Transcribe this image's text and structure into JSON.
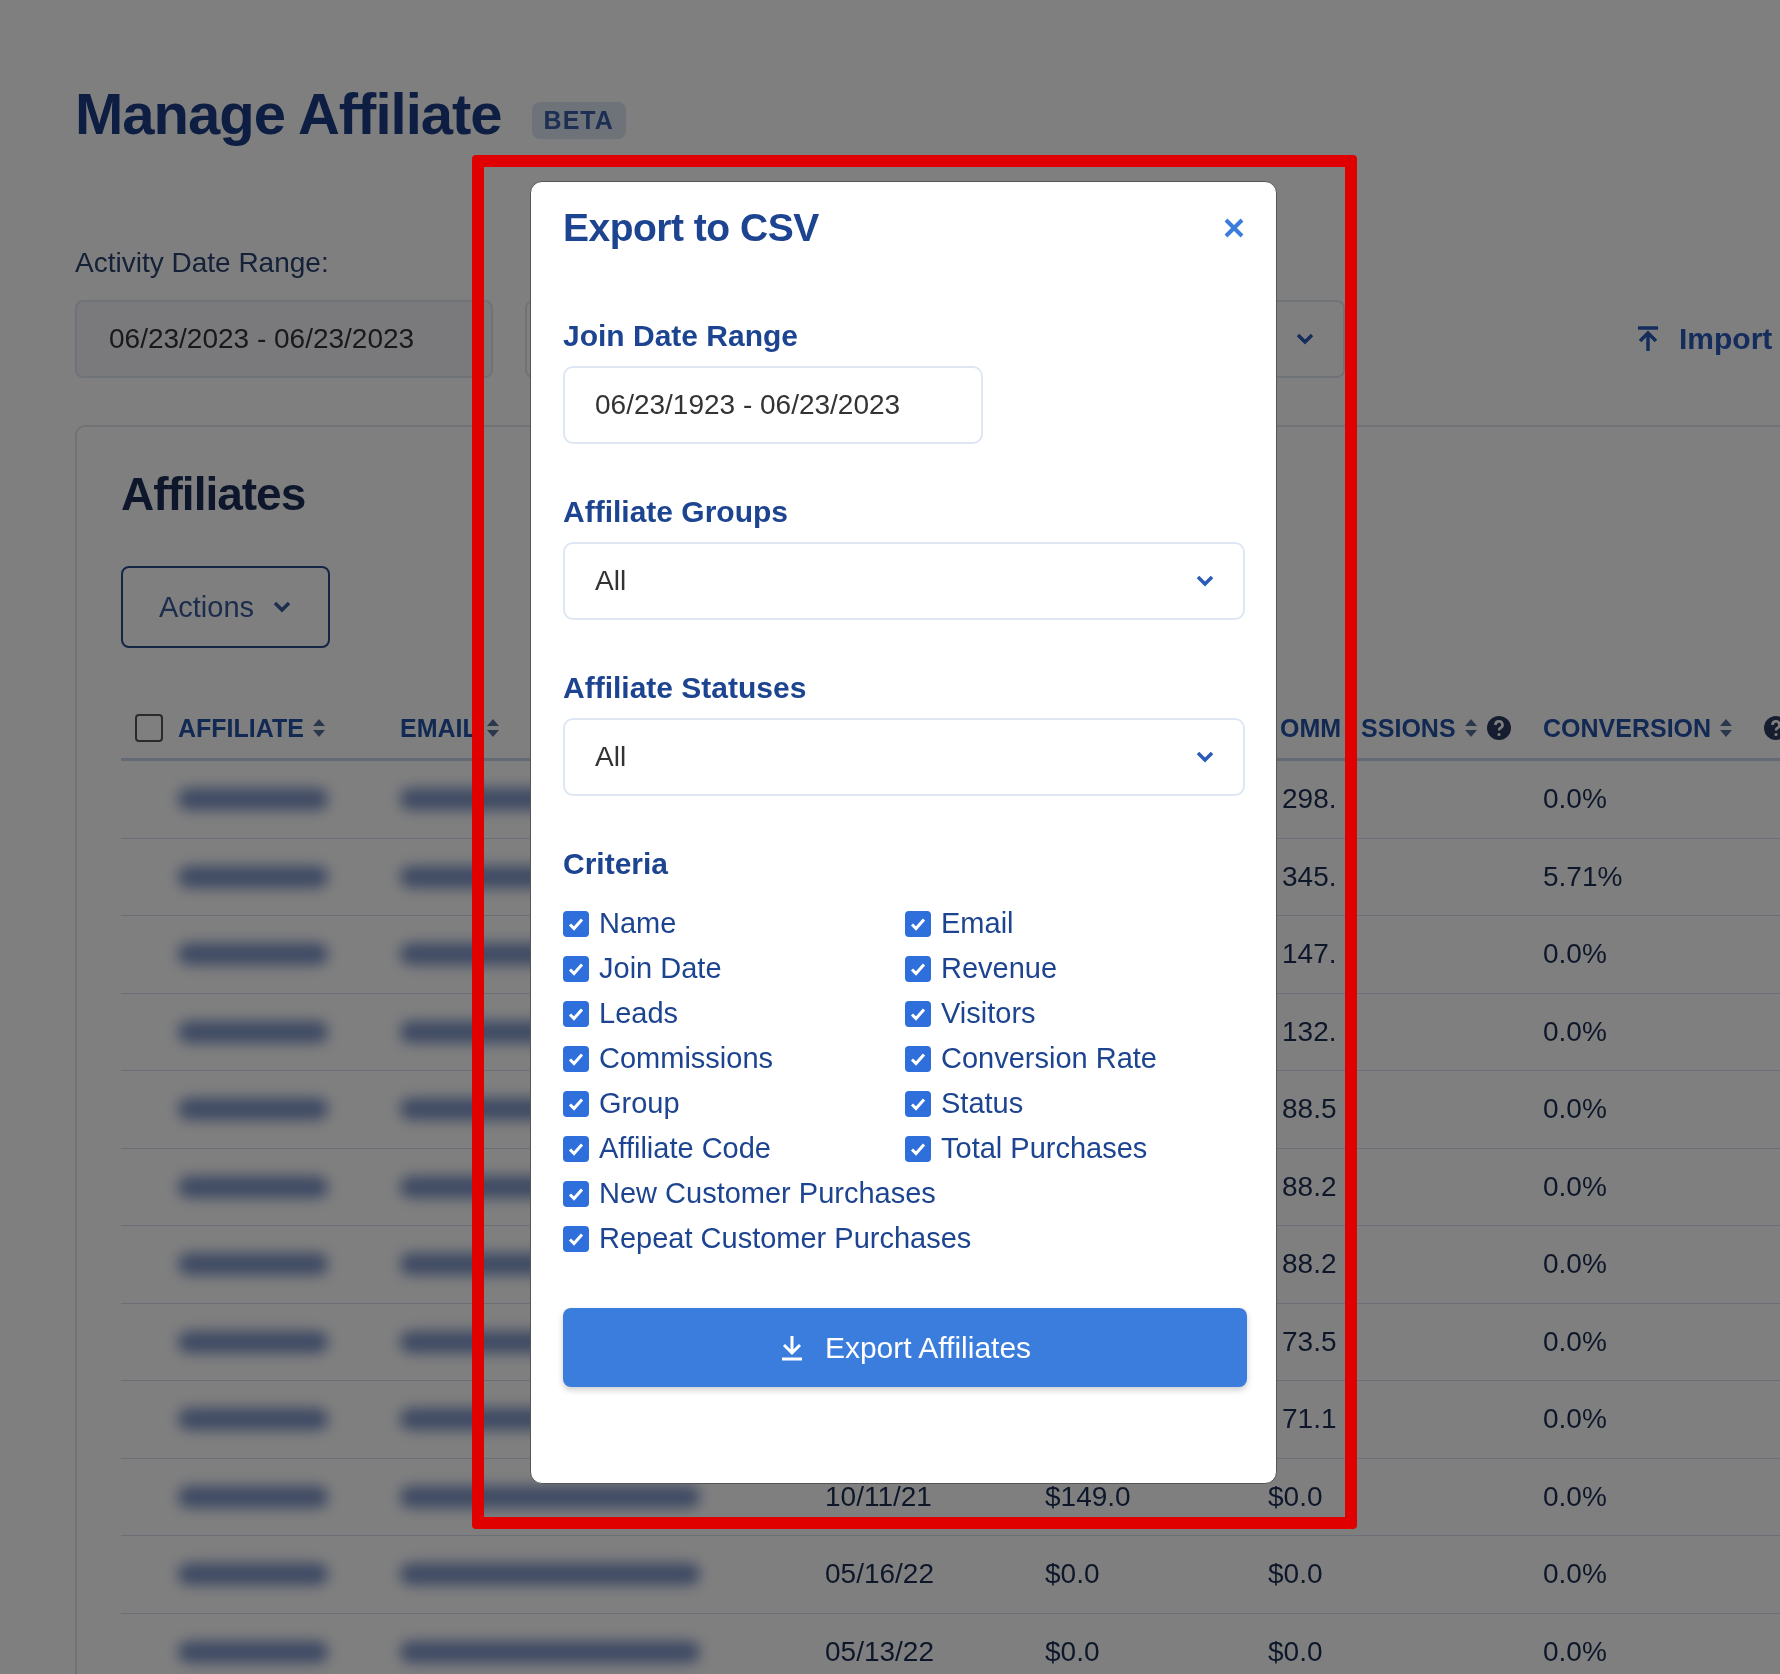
{
  "page": {
    "title": "Manage Affiliate",
    "badge": "BETA",
    "activity_label": "Activity Date Range:",
    "activity_range": "06/23/2023 - 06/23/2023",
    "import_label": "Import"
  },
  "affiliates": {
    "title": "Affiliates",
    "actions_label": "Actions",
    "header": {
      "checked": false,
      "columns": [
        {
          "label": "AFFILIATE",
          "help": false
        },
        {
          "label": "EMAIL"
        },
        {
          "fragment": "OMM",
          "label": "SSIONS",
          "help": true
        },
        {
          "label": "CONVERSION",
          "help": true
        }
      ]
    },
    "rows": [
      {
        "commissions": "298.",
        "conversion": "0.0%"
      },
      {
        "commissions": "345.",
        "conversion": "5.71%"
      },
      {
        "commissions": "147.",
        "conversion": "0.0%"
      },
      {
        "commissions": "132.",
        "conversion": "0.0%"
      },
      {
        "commissions": "88.5",
        "conversion": "0.0%"
      },
      {
        "commissions": "88.2",
        "conversion": "0.0%"
      },
      {
        "commissions": "88.2",
        "conversion": "0.0%"
      },
      {
        "commissions": "73.5",
        "conversion": "0.0%"
      },
      {
        "commissions": "71.1",
        "conversion": "0.0%"
      },
      {
        "join_date": "10/11/21",
        "revenue": "$149.0",
        "commissions": "$0.0",
        "conversion": "0.0%"
      },
      {
        "join_date": "05/16/22",
        "revenue": "$0.0",
        "commissions": "$0.0",
        "conversion": "0.0%"
      },
      {
        "join_date": "05/13/22",
        "revenue": "$0.0",
        "commissions": "$0.0",
        "conversion": "0.0%"
      }
    ]
  },
  "modal": {
    "title": "Export to CSV",
    "join_label": "Join Date Range",
    "join_range": "06/23/1923 - 06/23/2023",
    "groups_label": "Affiliate Groups",
    "groups_value": "All",
    "statuses_label": "Affiliate Statuses",
    "statuses_value": "All",
    "criteria_label": "Criteria",
    "criteria": [
      {
        "label": "Name",
        "checked": true
      },
      {
        "label": "Email",
        "checked": true
      },
      {
        "label": "Join Date",
        "checked": true
      },
      {
        "label": "Revenue",
        "checked": true
      },
      {
        "label": "Leads",
        "checked": true
      },
      {
        "label": "Visitors",
        "checked": true
      },
      {
        "label": "Commissions",
        "checked": true
      },
      {
        "label": "Conversion Rate",
        "checked": true
      },
      {
        "label": "Group",
        "checked": true
      },
      {
        "label": "Status",
        "checked": true
      },
      {
        "label": "Affiliate Code",
        "checked": true
      },
      {
        "label": "Total Purchases",
        "checked": true
      }
    ],
    "criteria_wide": [
      {
        "label": "New Customer Purchases",
        "checked": true
      },
      {
        "label": "Repeat Customer Purchases",
        "checked": true
      }
    ],
    "export_label": "Export Affiliates"
  }
}
